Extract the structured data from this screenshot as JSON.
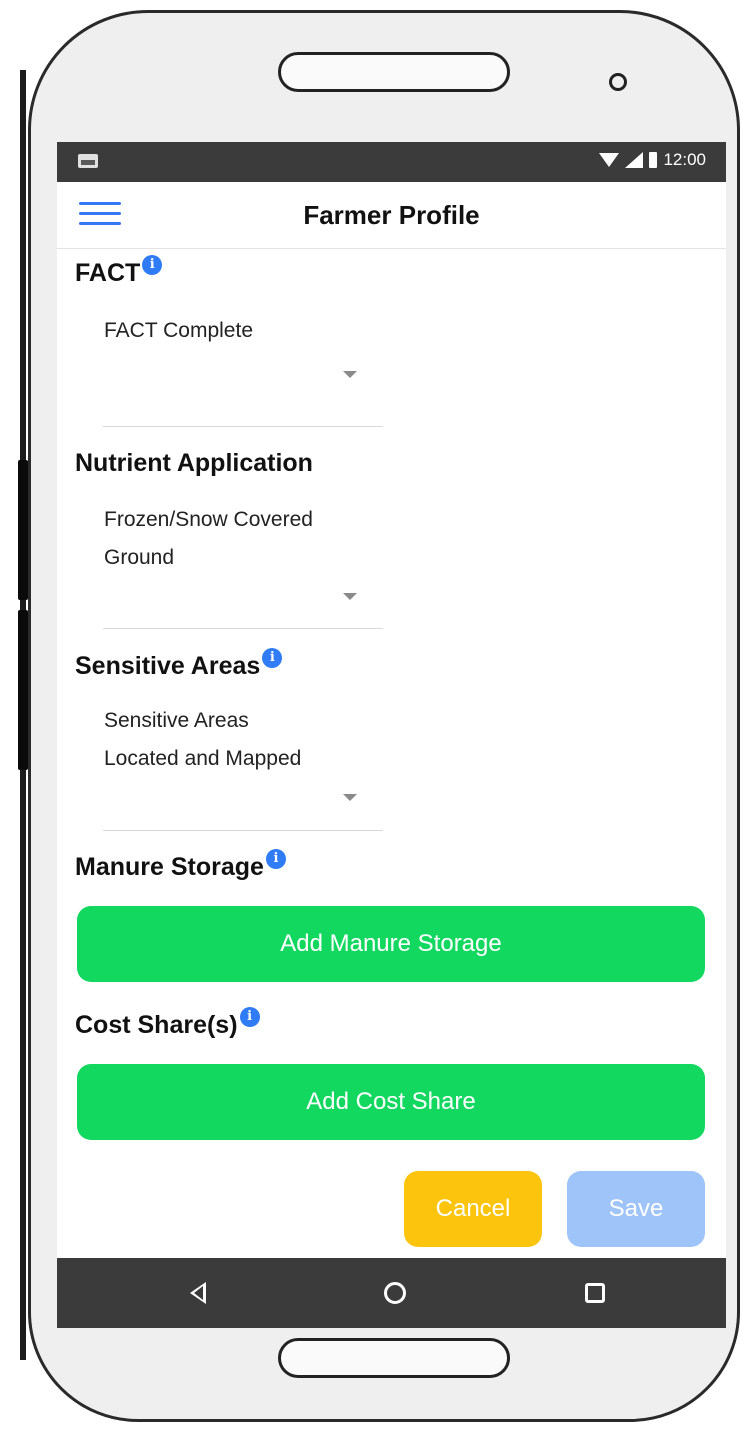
{
  "status_bar": {
    "time": "12:00"
  },
  "app_bar": {
    "title": "Farmer Profile"
  },
  "sections": {
    "fact": {
      "title": "FACT",
      "value": "FACT Complete"
    },
    "nutrient": {
      "title": "Nutrient Application",
      "value_line1": "Frozen/Snow Covered",
      "value_line2": "Ground"
    },
    "sensitive": {
      "title": "Sensitive Areas",
      "value_line1": "Sensitive Areas",
      "value_line2": "Located and Mapped"
    },
    "manure": {
      "title": "Manure Storage",
      "button_label": "Add Manure Storage"
    },
    "cost_share": {
      "title": "Cost Share(s)",
      "button_label": "Add Cost Share"
    }
  },
  "actions": {
    "cancel_label": "Cancel",
    "save_label": "Save"
  },
  "icons": {
    "info": "info-icon",
    "menu": "hamburger-icon",
    "back": "back-icon",
    "home": "home-icon",
    "recent": "recent-apps-icon"
  },
  "colors": {
    "accent": "#3478f6",
    "primary_button": "#12d860",
    "cancel": "#fcc40c",
    "save_disabled": "#9ec4f9"
  }
}
